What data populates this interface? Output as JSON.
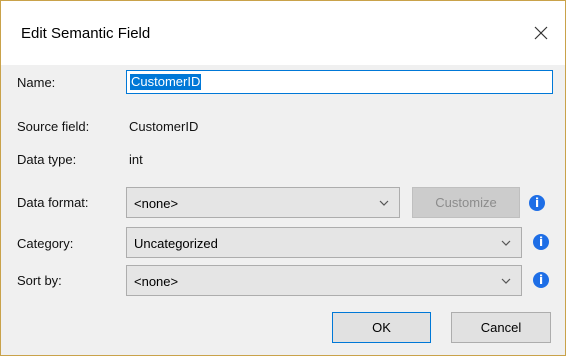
{
  "dialog": {
    "title": "Edit Semantic Field"
  },
  "fields": {
    "name_label": "Name:",
    "name_value": "CustomerID",
    "source_label": "Source field:",
    "source_value": "CustomerID",
    "type_label": "Data type:",
    "type_value": "int",
    "format_label": "Data format:",
    "format_value": "<none>",
    "customize_label": "Customize",
    "category_label": "Category:",
    "category_value": "Uncategorized",
    "sort_label": "Sort by:",
    "sort_value": "<none>"
  },
  "info_glyph": "i",
  "buttons": {
    "ok": "OK",
    "cancel": "Cancel"
  },
  "colors": {
    "accent": "#0078d7",
    "info": "#1e6ee6"
  }
}
